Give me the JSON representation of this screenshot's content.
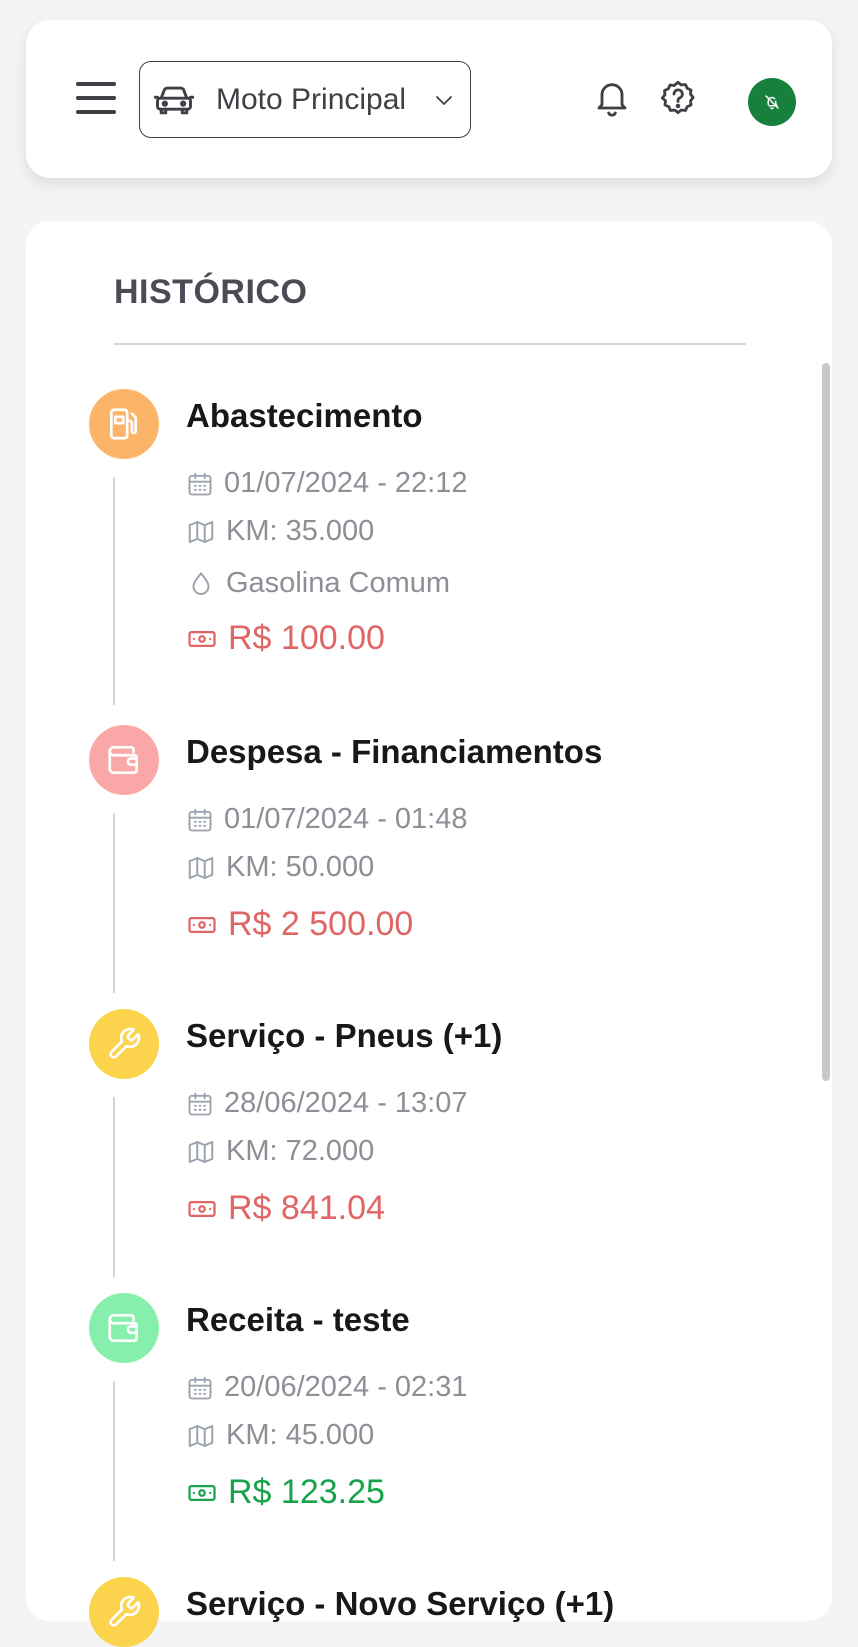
{
  "header": {
    "vehicle_select": {
      "label": "Moto Principal",
      "icon": "car-icon"
    },
    "icons": [
      "menu-icon",
      "bell-icon",
      "help-icon",
      "bell-off-icon"
    ]
  },
  "history": {
    "title": "HISTÓRICO",
    "entries": [
      {
        "title": "Abastecimento",
        "icon": "fuel-pump-icon",
        "icon_bg": "#fbb468",
        "datetime": "01/07/2024 - 22:12",
        "km": "KM: 35.000",
        "fuel": "Gasolina Comum",
        "amount": "R$ 100.00",
        "amount_color": "#e06666"
      },
      {
        "title": "Despesa - Financiamentos",
        "icon": "wallet-icon",
        "icon_bg": "#f9a7a7",
        "datetime": "01/07/2024 - 01:48",
        "km": "KM: 50.000",
        "amount": "R$ 2 500.00",
        "amount_color": "#e06666"
      },
      {
        "title": "Serviço - Pneus (+1)",
        "icon": "wrench-icon",
        "icon_bg": "#fcd34d",
        "datetime": "28/06/2024 - 13:07",
        "km": "KM: 72.000",
        "amount": "R$ 841.04",
        "amount_color": "#e06666"
      },
      {
        "title": "Receita - teste",
        "icon": "wallet-icon",
        "icon_bg": "#86efac",
        "datetime": "20/06/2024 - 02:31",
        "km": "KM: 45.000",
        "amount": "R$ 123.25",
        "amount_color": "#16a34a"
      },
      {
        "title": "Serviço - Novo Serviço (+1)",
        "icon": "wrench-icon",
        "icon_bg": "#fcd34d"
      }
    ]
  }
}
